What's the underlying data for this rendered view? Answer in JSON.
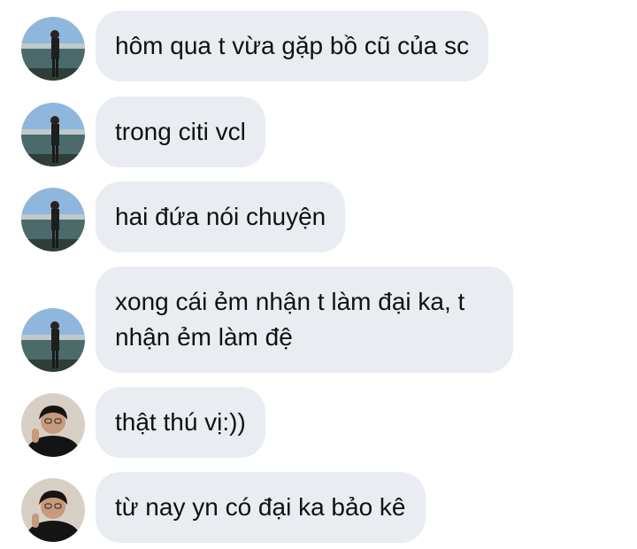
{
  "messages": [
    {
      "sender": "friend-landscape",
      "text": "hôm qua t vừa gặp bồ cũ của sc"
    },
    {
      "sender": "friend-landscape",
      "text": "trong citi vcl"
    },
    {
      "sender": "friend-landscape",
      "text": "hai đứa nói chuyện"
    },
    {
      "sender": "friend-landscape",
      "text": "xong cái ẻm nhận t làm đại ka, t\nnhận ẻm làm đệ"
    },
    {
      "sender": "friend-portrait",
      "text": "thật thú vị:))"
    },
    {
      "sender": "friend-portrait",
      "text": "từ nay yn có đại ka bảo kê"
    }
  ],
  "colors": {
    "bubble_bg": "#e9ecf0",
    "text": "#111111",
    "page_bg": "#ffffff"
  }
}
